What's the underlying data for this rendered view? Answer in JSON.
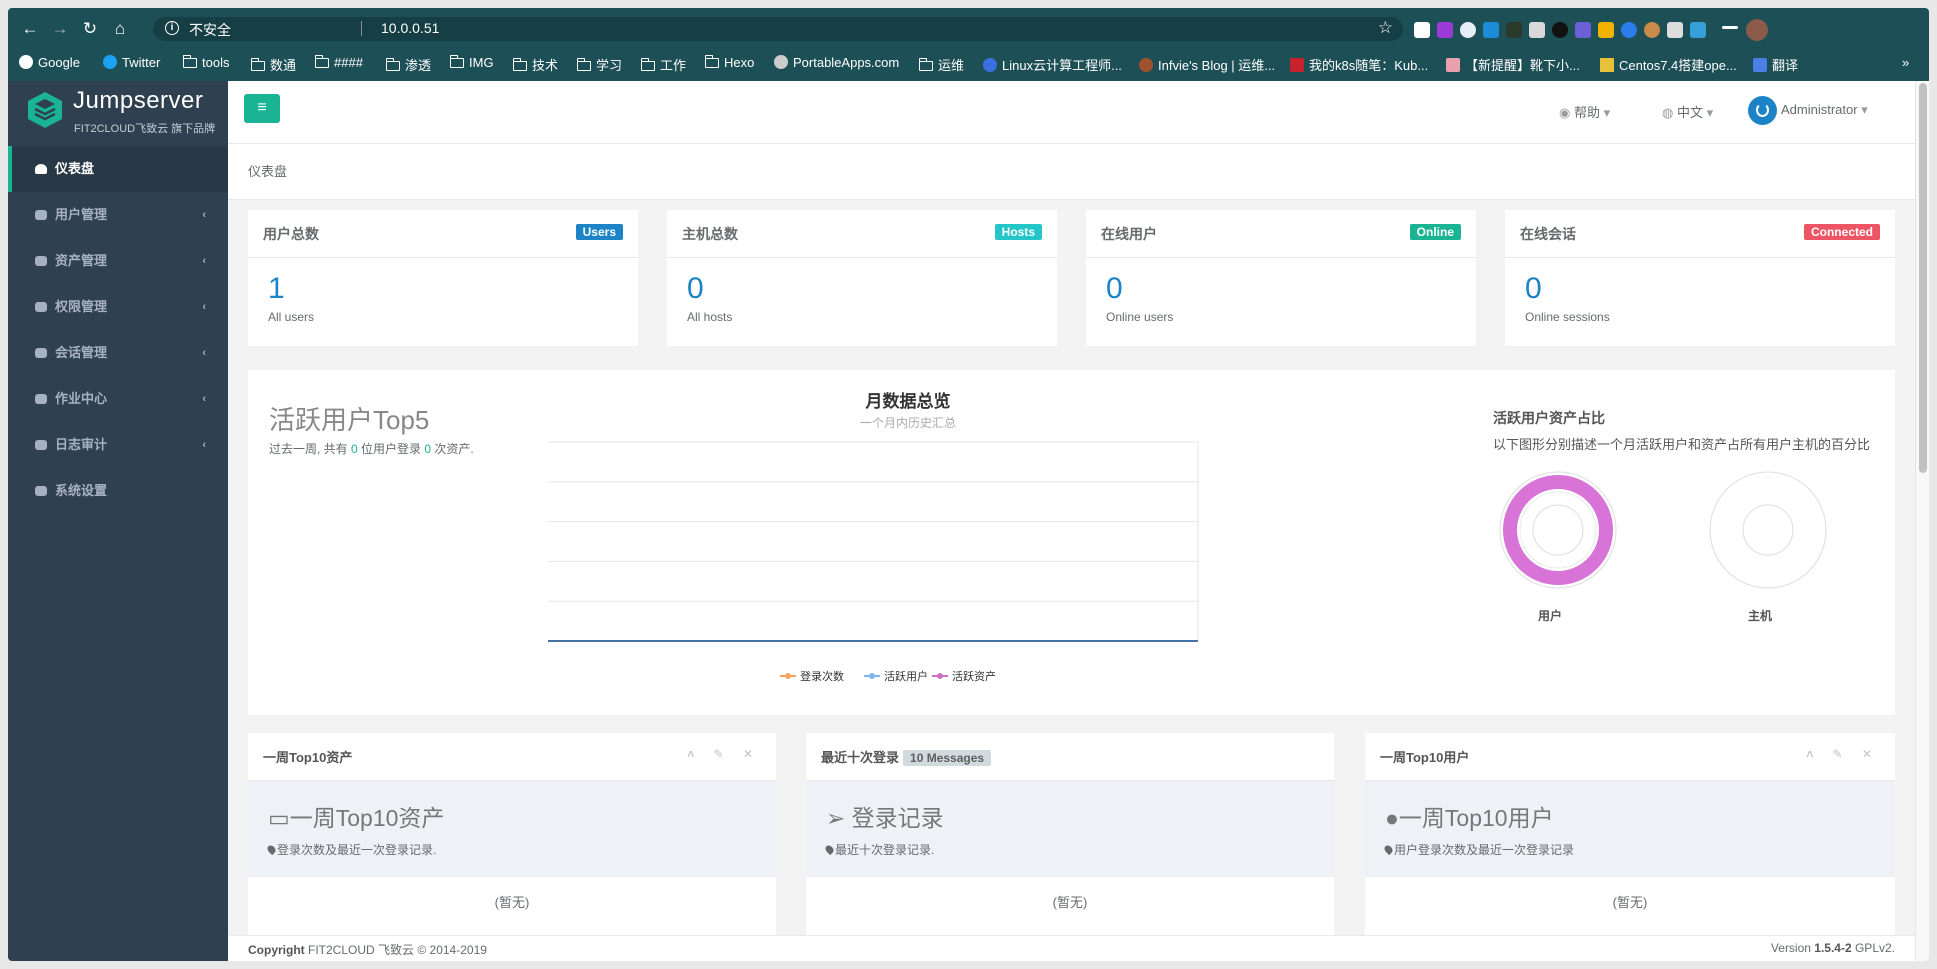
{
  "browser": {
    "security_label": "不安全",
    "url": "10.0.0.51",
    "bookmarks": [
      "Google",
      "Twitter",
      "tools",
      "数通",
      "####",
      "渗透",
      "IMG",
      "技术",
      "学习",
      "工作",
      "Hexo",
      "PortableApps.com",
      "运维",
      "Linux云计算工程师...",
      "Infvie's Blog | 运维...",
      "我的k8s随笔：Kub...",
      "【新提醒】靴下小...",
      "Centos7.4搭建ope...",
      "翻译"
    ],
    "more": "»"
  },
  "sidebar": {
    "logo_title": "Jumpserver",
    "logo_subtitle": "FIT2CLOUD飞致云 旗下品牌",
    "items": [
      "仪表盘",
      "用户管理",
      "资产管理",
      "权限管理",
      "会话管理",
      "作业中心",
      "日志审计",
      "系统设置"
    ]
  },
  "topbar": {
    "menu_icon": "≡",
    "help": "帮助",
    "lang": "中文",
    "user": "Administrator"
  },
  "breadcrumb": "仪表盘",
  "stats": [
    {
      "title": "用户总数",
      "badge": "Users",
      "color": "#1c84c6",
      "value": "1",
      "sub": "All users"
    },
    {
      "title": "主机总数",
      "badge": "Hosts",
      "color": "#23c6c8",
      "value": "0",
      "sub": "All hosts"
    },
    {
      "title": "在线用户",
      "badge": "Online",
      "color": "#1ab394",
      "value": "0",
      "sub": "Online users"
    },
    {
      "title": "在线会话",
      "badge": "Connected",
      "color": "#ed5565",
      "value": "0",
      "sub": "Online sessions"
    }
  ],
  "top5": {
    "title": "活跃用户Top5",
    "sub_pre": "过去一周, 共有 ",
    "users": "0",
    "sub_mid": " 位用户登录 ",
    "assets": "0",
    "sub_post": " 次资产."
  },
  "chart_data": {
    "type": "line",
    "title": "月数据总览",
    "subtitle": "一个月内历史汇总",
    "x": [
      "0"
    ],
    "ylim": [
      0,
      5
    ],
    "yticks": [
      "0",
      "1",
      "2",
      "3",
      "4",
      "5"
    ],
    "series": [
      {
        "name": "登录次数",
        "values": [
          0
        ],
        "color": "#f7a35c"
      },
      {
        "name": "活跃用户",
        "values": [
          0
        ],
        "color": "#7cb5ec"
      },
      {
        "name": "活跃资产",
        "values": [
          0
        ],
        "color": "#d070c0"
      }
    ]
  },
  "ratio": {
    "title": "活跃用户资产占比",
    "desc": "以下图形分别描述一个月活跃用户和资产占所有用户主机的百分比",
    "user_label": "用户",
    "host_label": "主机",
    "user_color": "#d873d8"
  },
  "panels": [
    {
      "header": "一周Top10资产",
      "title": "一周Top10资产",
      "desc": "登录次数及最近一次登录记录.",
      "empty": "(暂无)"
    },
    {
      "header": "最近十次登录",
      "badge": "10 Messages",
      "title": "登录记录",
      "desc": "最近十次登录记录.",
      "empty": "(暂无)"
    },
    {
      "header": "一周Top10用户",
      "title": "一周Top10用户",
      "desc": "用户登录次数及最近一次登录记录",
      "empty": "(暂无)"
    }
  ],
  "footer": {
    "copy_bold": "Copyright",
    "copy": " FIT2CLOUD 飞致云 © 2014-2019",
    "ver_pre": "Version ",
    "ver": "1.5.4-2",
    "ver_post": " GPLv2."
  }
}
